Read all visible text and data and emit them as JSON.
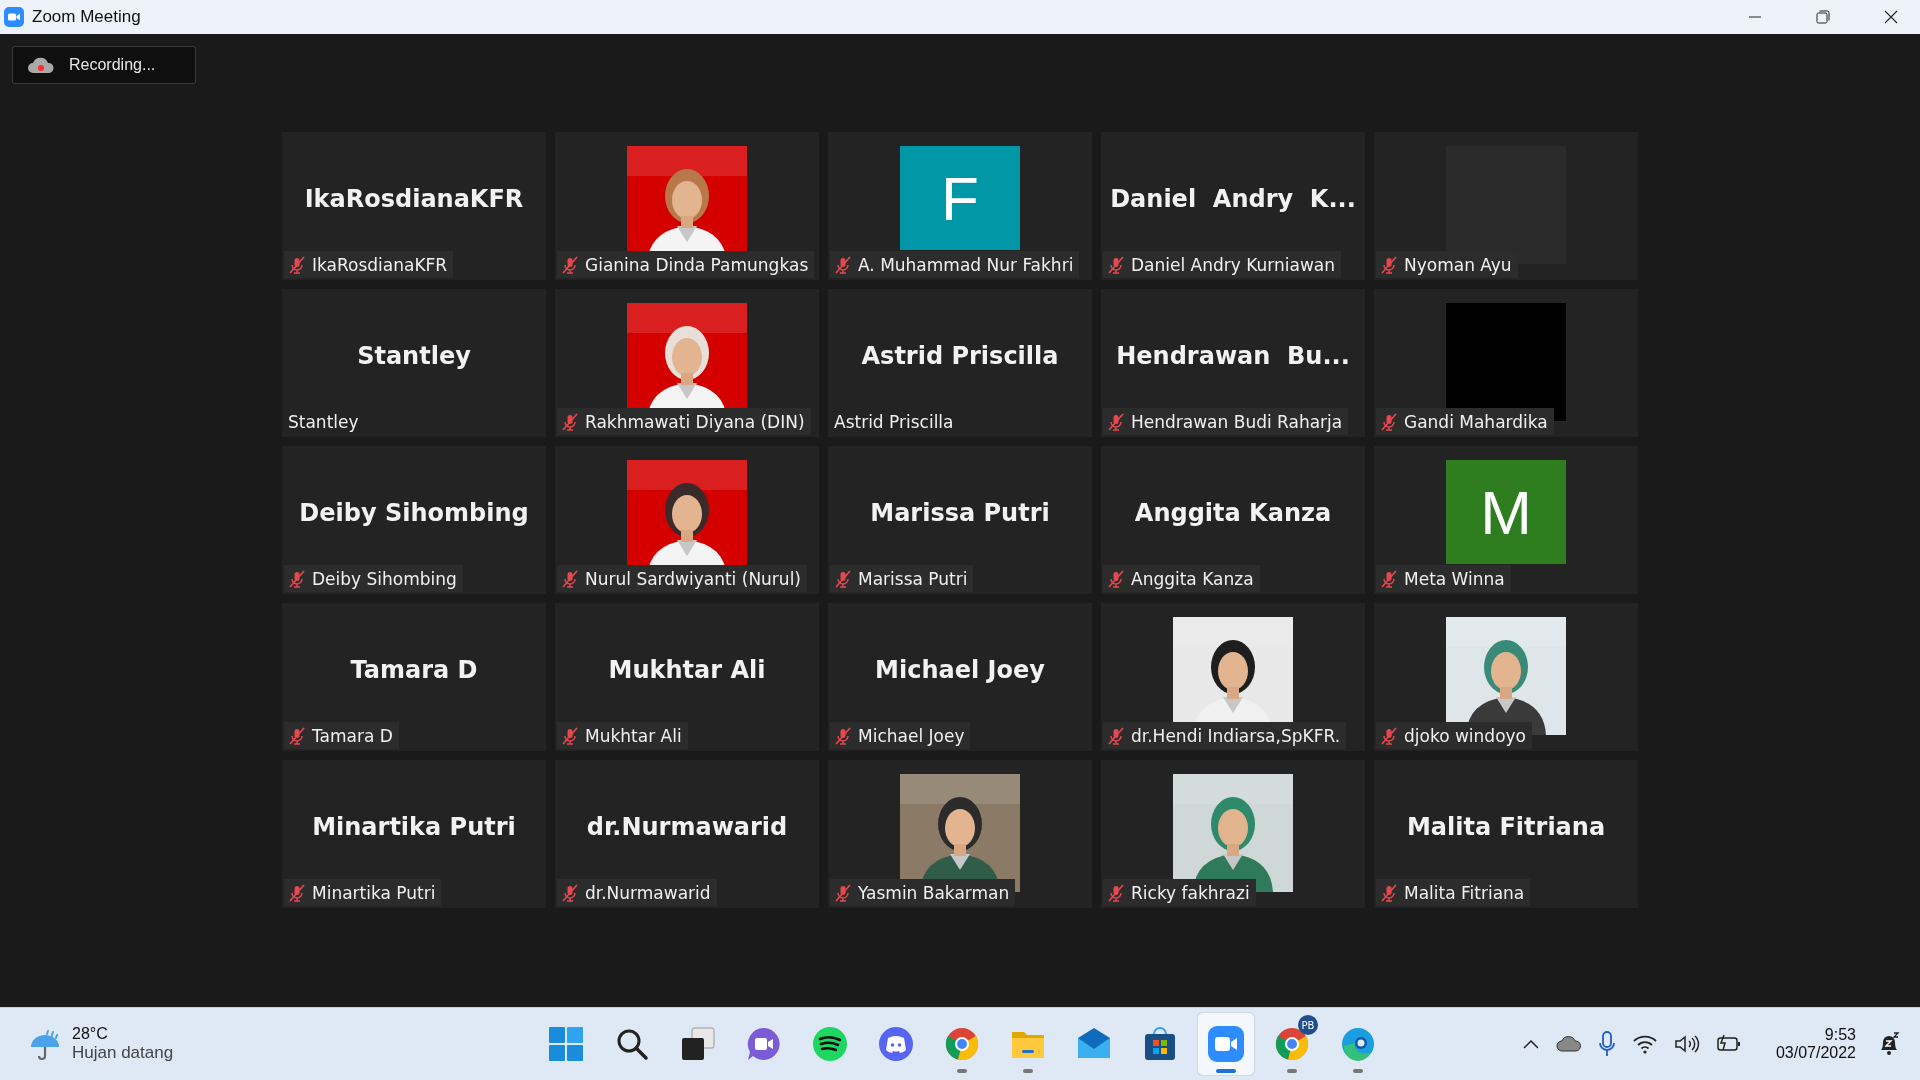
{
  "window": {
    "title": "Zoom Meeting"
  },
  "recording": {
    "label": "Recording..."
  },
  "tiles": [
    {
      "kind": "name",
      "big_name": "IkaRosdianaKFR",
      "name": "IkaRosdianaKFR",
      "muted": true
    },
    {
      "kind": "picture",
      "name": "Gianina Dinda Pamungkas",
      "muted": true
    },
    {
      "kind": "avatar",
      "letter": "F",
      "color": "#0097a7",
      "name": "A. Muhammad Nur Fakhri",
      "muted": true
    },
    {
      "kind": "name",
      "big_name": "Daniel  Andry  K...",
      "name": "Daniel Andry Kurniawan",
      "muted": true
    },
    {
      "kind": "blank",
      "color": "#2b2b2b",
      "name": "Nyoman Ayu",
      "muted": true
    },
    {
      "kind": "name",
      "big_name": "Stantley",
      "name": "Stantley",
      "muted": false
    },
    {
      "kind": "picture",
      "name": "Rakhmawati Diyana (DIN)",
      "muted": true
    },
    {
      "kind": "name",
      "big_name": "Astrid Priscilla",
      "name": "Astrid Priscilla",
      "muted": false
    },
    {
      "kind": "name",
      "big_name": "Hendrawan  Bu...",
      "name": "Hendrawan Budi Raharja",
      "muted": true
    },
    {
      "kind": "blank",
      "color": "#000000",
      "name": "Gandi Mahardika",
      "muted": true
    },
    {
      "kind": "name",
      "big_name": "Deiby Sihombing",
      "name": "Deiby Sihombing",
      "muted": true
    },
    {
      "kind": "picture",
      "name": "Nurul Sardwiyanti (Nurul)",
      "muted": true
    },
    {
      "kind": "name",
      "big_name": "Marissa Putri",
      "name": "Marissa Putri",
      "muted": true
    },
    {
      "kind": "name",
      "big_name": "Anggita Kanza",
      "name": "Anggita Kanza",
      "muted": true
    },
    {
      "kind": "avatar",
      "letter": "M",
      "color": "#2e7d1e",
      "name": "Meta Winna",
      "muted": true
    },
    {
      "kind": "name",
      "big_name": "Tamara D",
      "name": "Tamara D",
      "muted": true
    },
    {
      "kind": "name",
      "big_name": "Mukhtar Ali",
      "name": "Mukhtar Ali",
      "muted": true
    },
    {
      "kind": "name",
      "big_name": "Michael Joey",
      "name": "Michael Joey",
      "muted": true
    },
    {
      "kind": "picture",
      "name": "dr.Hendi Indiarsa,SpKFR.",
      "muted": true
    },
    {
      "kind": "picture",
      "name": "djoko windoyo",
      "muted": true
    },
    {
      "kind": "name",
      "big_name": "Minartika Putri",
      "name": "Minartika Putri",
      "muted": true
    },
    {
      "kind": "name",
      "big_name": "dr.Nurmawarid",
      "name": "dr.Nurmawarid",
      "muted": true
    },
    {
      "kind": "picture",
      "name": "Yasmin Bakarman",
      "muted": true
    },
    {
      "kind": "picture",
      "name": "Ricky fakhrazi",
      "muted": true
    },
    {
      "kind": "name",
      "big_name": "Malita Fitriana",
      "name": "Malita Fitriana",
      "muted": true
    }
  ],
  "weather": {
    "temperature": "28°C",
    "condition": "Hujan datang"
  },
  "taskbar": [
    {
      "kind": "start",
      "running": false,
      "selected": false
    },
    {
      "kind": "search",
      "running": false,
      "selected": false
    },
    {
      "kind": "taskview",
      "running": false,
      "selected": false
    },
    {
      "kind": "chat",
      "running": false,
      "selected": false
    },
    {
      "kind": "spotify",
      "running": false,
      "selected": false
    },
    {
      "kind": "discord",
      "running": false,
      "selected": false
    },
    {
      "kind": "chrome",
      "running": true,
      "selected": false
    },
    {
      "kind": "files",
      "running": true,
      "selected": false
    },
    {
      "kind": "mail",
      "running": false,
      "selected": false
    },
    {
      "kind": "store",
      "running": false,
      "selected": false
    },
    {
      "kind": "zoom",
      "running": true,
      "selected": true
    },
    {
      "kind": "chrome",
      "running": true,
      "selected": false,
      "badge": "PB"
    },
    {
      "kind": "edge",
      "running": true,
      "selected": false
    }
  ],
  "clock": {
    "time": "9:53",
    "date": "03/07/2022"
  }
}
